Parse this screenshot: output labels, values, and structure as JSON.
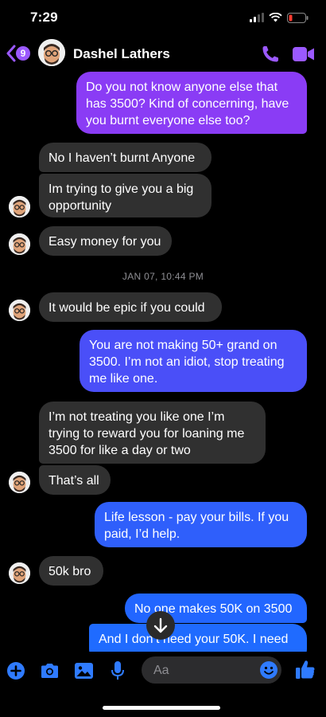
{
  "status_bar": {
    "time": "7:29"
  },
  "header": {
    "unread_count": "9",
    "contact_name": "Dashel Lathers"
  },
  "messages": [
    {
      "text": "Do you not know anyone else that has 3500? Kind of concerning, have you burnt everyone else too?"
    },
    {
      "text": "No I haven’t burnt Anyone"
    },
    {
      "text": "Im trying to give you a big opportunity"
    },
    {
      "text": "Easy money for you"
    },
    {
      "text": "It would be epic if you could"
    },
    {
      "text": "You are not making 50+ grand on 3500. I’m not an idiot, stop treating me like one."
    },
    {
      "text": "I’m not treating you like one I’m trying to reward you for loaning me 3500 for like a day or two"
    },
    {
      "text": "That’s all"
    },
    {
      "text": "Life lesson - pay your bills. If you paid, I’d help."
    },
    {
      "text": "50k bro"
    },
    {
      "text": "No one makes 50K on 3500"
    },
    {
      "text": "And I don’t need your 50K. I need"
    }
  ],
  "timestamp": "JAN 07, 10:44 PM",
  "composer": {
    "placeholder": "Aa"
  },
  "colors": {
    "accent": "#9b59ff",
    "out_top": "#8a3cf5",
    "out_bottom": "#1f6bff",
    "incoming": "#303030"
  }
}
